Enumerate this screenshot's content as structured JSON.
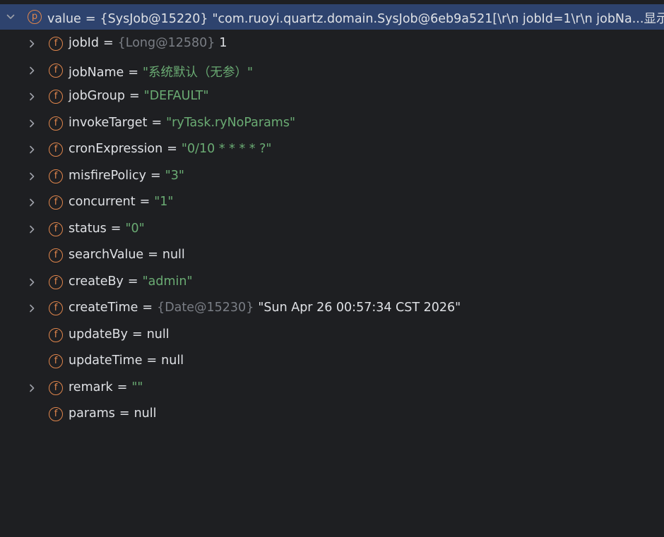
{
  "header": {
    "badge": "p",
    "name": "value",
    "operator": "=",
    "ref": "{SysJob@15220}",
    "value": "\"com.ruoyi.quartz.domain.SysJob@6eb9a521[\\r\\n  jobId=1\\r\\n  jobNa...",
    "show_link": "显示"
  },
  "fields": [
    {
      "badge": "f",
      "name": "jobId",
      "operator": "=",
      "ref": "{Long@12580}",
      "value": "1",
      "kind": "plain",
      "expandable": true
    },
    {
      "badge": "f",
      "name": "jobName",
      "operator": "=",
      "ref": "",
      "value": "\"系统默认（无参）\"",
      "kind": "str",
      "expandable": true
    },
    {
      "badge": "f",
      "name": "jobGroup",
      "operator": "=",
      "ref": "",
      "value": "\"DEFAULT\"",
      "kind": "str",
      "expandable": true
    },
    {
      "badge": "f",
      "name": "invokeTarget",
      "operator": "=",
      "ref": "",
      "value": "\"ryTask.ryNoParams\"",
      "kind": "str",
      "expandable": true
    },
    {
      "badge": "f",
      "name": "cronExpression",
      "operator": "=",
      "ref": "",
      "value": "\"0/10 * * * * ?\"",
      "kind": "str",
      "expandable": true
    },
    {
      "badge": "f",
      "name": "misfirePolicy",
      "operator": "=",
      "ref": "",
      "value": "\"3\"",
      "kind": "str",
      "expandable": true
    },
    {
      "badge": "f",
      "name": "concurrent",
      "operator": "=",
      "ref": "",
      "value": "\"1\"",
      "kind": "str",
      "expandable": true
    },
    {
      "badge": "f",
      "name": "status",
      "operator": "=",
      "ref": "",
      "value": "\"0\"",
      "kind": "str",
      "expandable": true
    },
    {
      "badge": "f",
      "name": "searchValue",
      "operator": "=",
      "ref": "",
      "value": "null",
      "kind": "plain",
      "expandable": false
    },
    {
      "badge": "f",
      "name": "createBy",
      "operator": "=",
      "ref": "",
      "value": "\"admin\"",
      "kind": "str",
      "expandable": true
    },
    {
      "badge": "f",
      "name": "createTime",
      "operator": "=",
      "ref": "{Date@15230}",
      "value": "\"Sun Apr 26 00:57:34 CST 2026\"",
      "kind": "plain",
      "expandable": true
    },
    {
      "badge": "f",
      "name": "updateBy",
      "operator": "=",
      "ref": "",
      "value": "null",
      "kind": "plain",
      "expandable": false
    },
    {
      "badge": "f",
      "name": "updateTime",
      "operator": "=",
      "ref": "",
      "value": "null",
      "kind": "plain",
      "expandable": false
    },
    {
      "badge": "f",
      "name": "remark",
      "operator": "=",
      "ref": "",
      "value": "\"\"",
      "kind": "str",
      "expandable": true
    },
    {
      "badge": "f",
      "name": "params",
      "operator": "=",
      "ref": "",
      "value": "null",
      "kind": "plain",
      "expandable": false
    }
  ],
  "colors": {
    "background": "#1e1f22",
    "selection": "#2e436e",
    "text": "#dfe1e5",
    "string": "#6aab73",
    "reference": "#7a7e85",
    "badge": "#e0864c",
    "chevron": "#9da0a8"
  },
  "icons": {
    "expand": "chevron-right-icon",
    "collapse": "chevron-down-icon",
    "property": "property-badge-icon",
    "field": "field-badge-icon"
  }
}
